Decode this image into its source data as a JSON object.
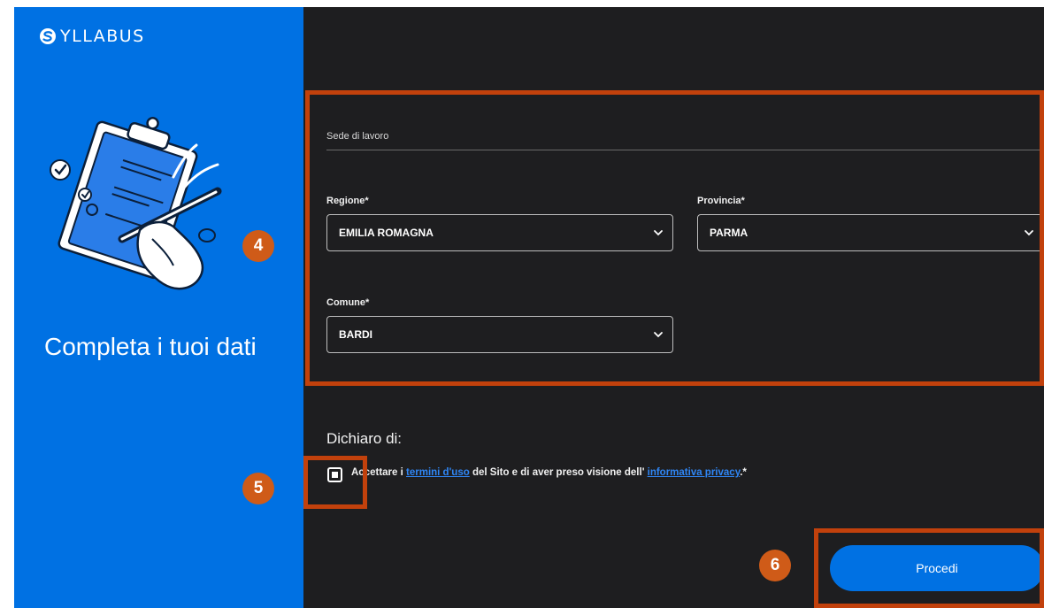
{
  "brand": {
    "name": "YLLABUS"
  },
  "sidebar": {
    "title": "Completa i tuoi dati"
  },
  "form": {
    "section_title": "Sede di lavoro",
    "regione": {
      "label": "Regione*",
      "value": "EMILIA ROMAGNA"
    },
    "provincia": {
      "label": "Provincia*",
      "value": "PARMA"
    },
    "comune": {
      "label": "Comune*",
      "value": "BARDI"
    }
  },
  "declaration": {
    "title": "Dichiaro di:",
    "prefix": "Accettare i ",
    "terms_link": "termini d'uso",
    "middle": " del Sito e di aver preso visione dell' ",
    "privacy_link": "informativa privacy",
    "suffix": ".*",
    "checked": true
  },
  "actions": {
    "submit_label": "Procedi"
  },
  "annotations": {
    "step4": "4",
    "step5": "5",
    "step6": "6"
  },
  "colors": {
    "brand_blue": "#0071e3",
    "panel_dark": "#1e1e20",
    "annotation": "#c2410c",
    "link": "#2f86f5"
  },
  "icons": [
    "syllabus-logo-icon",
    "clipboard-illustration",
    "chevron-down-icon",
    "checkbox-icon"
  ]
}
